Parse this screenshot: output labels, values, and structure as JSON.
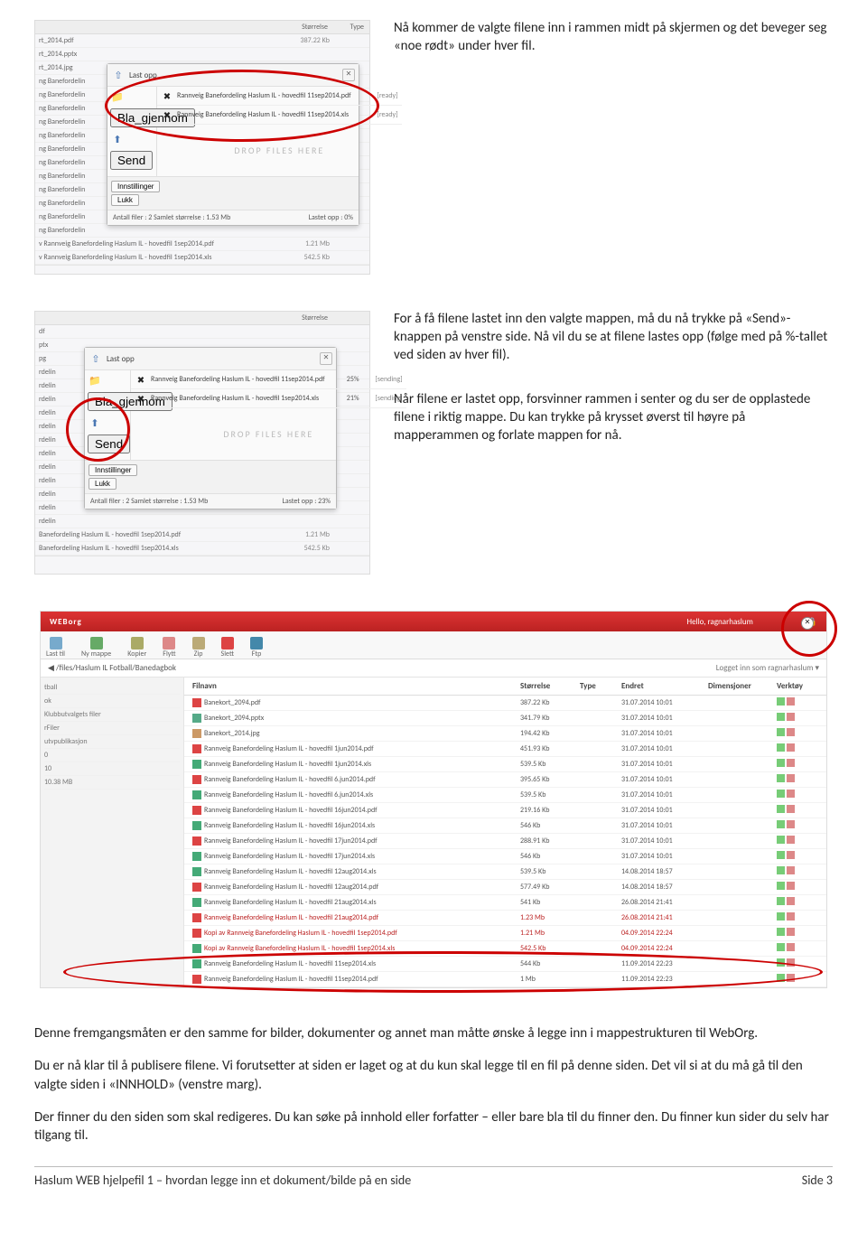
{
  "paragraphs": {
    "p1": "Nå kommer de valgte filene inn i rammen midt på skjermen og det beveger seg «noe rødt» under hver fil.",
    "p2": "For å få filene lastet inn den valgte mappen, må du nå trykke på «Send»-knappen på venstre side. Nå vil du se at filene lastes opp (følge med på %-tallet ved siden av hver fil).",
    "p3": "Når filene er lastet opp, forsvinner rammen i senter og du ser de opplastede filene i riktig mappe.  Du kan trykke på krysset øverst til høyre på mapperammen og forlate mappen for nå.",
    "p4": "Denne fremgangsmåten er den samme for bilder, dokumenter og annet man måtte ønske å legge inn i mappestrukturen til WebOrg.",
    "p5": "Du er nå klar til å publisere filene.  Vi forutsetter at siden er laget og at du kun skal legge til en fil på denne siden. Det vil si at du må gå til den valgte siden i «INNHOLD» (venstre marg).",
    "p6": "Der finner du den siden som skal redigeres.  Du kan søke på innhold eller forfatter – eller bare bla til du finner den. Du finner kun sider du selv har tilgang til."
  },
  "footer": {
    "left": "Haslum WEB hjelpefil 1 – hvordan legge inn et dokument/bilde på en side",
    "right": "Side 3"
  },
  "bgfiles": {
    "header": {
      "size": "Størrelse",
      "type": "Type"
    },
    "items": [
      [
        "rt_2014.pdf",
        "387.22 Kb",
        ""
      ],
      [
        "rt_2014.pptx",
        "",
        ""
      ],
      [
        "rt_2014.jpg",
        "",
        ""
      ],
      [
        "ng Banefordelin",
        "",
        ""
      ],
      [
        "ng Banefordelin",
        "",
        ""
      ],
      [
        "ng Banefordelin",
        "",
        ""
      ],
      [
        "ng Banefordelin",
        "",
        ""
      ],
      [
        "ng Banefordelin",
        "",
        ""
      ],
      [
        "ng Banefordelin",
        "",
        ""
      ],
      [
        "ng Banefordelin",
        "",
        ""
      ],
      [
        "ng Banefordelin",
        "",
        ""
      ],
      [
        "ng Banefordelin",
        "",
        ""
      ],
      [
        "ng Banefordelin",
        "",
        ""
      ],
      [
        "ng Banefordelin",
        "",
        ""
      ],
      [
        "ng Banefordelin",
        "",
        ""
      ],
      [
        "v Rannveig Banefordeling Haslum IL - hovedfil 1sep2014.pdf",
        "1.21 Mb",
        ""
      ],
      [
        "v Rannveig Banefordeling Haslum IL - hovedfil 1sep2014.xls",
        "542.5 Kb",
        ""
      ]
    ]
  },
  "bgfiles2": {
    "items": [
      [
        "df",
        "",
        ""
      ],
      [
        "ptx",
        "",
        ""
      ],
      [
        "pg",
        "",
        ""
      ],
      [
        "rdelin",
        "",
        ""
      ],
      [
        "rdelin",
        "",
        ""
      ],
      [
        "rdelin",
        "",
        ""
      ],
      [
        "rdelin",
        "",
        ""
      ],
      [
        "rdelin",
        "",
        ""
      ],
      [
        "rdelin",
        "",
        ""
      ],
      [
        "rdelin",
        "",
        ""
      ],
      [
        "rdelin",
        "",
        ""
      ],
      [
        "rdelin",
        "",
        ""
      ],
      [
        "rdelin",
        "",
        ""
      ],
      [
        "rdelin",
        "",
        ""
      ],
      [
        "rdelin",
        "",
        ""
      ],
      [
        "Banefordeling Haslum IL - hovedfil 1sep2014.pdf",
        "1.21 Mb",
        ""
      ],
      [
        "Banefordeling Haslum IL - hovedfil 1sep2014.xls",
        "542.5 Kb",
        ""
      ]
    ]
  },
  "panel1": {
    "head": "Last opp",
    "rows": [
      {
        "icon": "bla_gjennom",
        "name": "Rannveig Banefordeling Haslum IL - hovedfil 11sep2014.pdf",
        "status": "[ready]"
      },
      {
        "icon": "send",
        "name": "Rannveig Banefordeling Haslum IL - hovedfil 11sep2014.xls",
        "status": "[ready]"
      }
    ],
    "bla": "Bla_gjennom",
    "send": "Send",
    "drop": "DROP FILES HERE",
    "btns": [
      "Innstillinger",
      "Lukk"
    ],
    "foot_l": "Antall filer : 2 Samlet størrelse : 1.53 Mb",
    "foot_r": "Lastet opp : 0%"
  },
  "panel2": {
    "head": "Last opp",
    "rows": [
      {
        "name": "Rannveig Banefordeling Haslum IL - hovedfil 11sep2014.pdf",
        "pct": "25%",
        "status": "[sending]"
      },
      {
        "name": "Rannveig Banefordeling Haslum IL - hovedfil 1sep2014.xls",
        "pct": "21%",
        "status": "[sending]"
      }
    ],
    "bla": "Bla_gjennom",
    "send": "Send",
    "drop": "DROP FILES HERE",
    "btns": [
      "Innstillinger",
      "Lukk"
    ],
    "foot_l": "Antall filer : 2 Samlet størrelse : 1.53 Mb",
    "foot_r": "Lastet opp : 23%"
  },
  "web": {
    "brand": "WEBorg",
    "hello": "Hello, ragnarhaslum",
    "toolbar": [
      "Last til",
      "Ny mappe",
      "Kopier",
      "Flytt",
      "Zip",
      "Slett",
      "Ftp"
    ],
    "path": "/files/Haslum IL Fotball/Banedagbok",
    "login_as": "Logget inn som ragnarhaslum ▾",
    "side": [
      "tball",
      "ok",
      "Klubbutvalgets filer",
      "rFiler",
      "utvpublikasjon",
      "0",
      "10",
      "10.38 MB"
    ],
    "headers": [
      "Filnavn",
      "Størrelse",
      "Type",
      "Endret",
      "Dimensjoner",
      "Verktøy"
    ],
    "files": [
      [
        "pdf",
        "Banekort_2094.pdf",
        "387.22 Kb",
        "",
        "31.07.2014 10:01"
      ],
      [
        "doc",
        "Banekort_2094.pptx",
        "341.79 Kb",
        "",
        "31.07.2014 10:01"
      ],
      [
        "img",
        "Banekort_2014.jpg",
        "194.42 Kb",
        "",
        "31.07.2014 10:01"
      ],
      [
        "pdf",
        "Rannveig Banefordeling Haslum IL - hovedfil 1jun2014.pdf",
        "451.93 Kb",
        "",
        "31.07.2014 10:01"
      ],
      [
        "xls",
        "Rannveig Banefordeling Haslum IL - hovedfil 1jun2014.xls",
        "539.5 Kb",
        "",
        "31.07.2014 10:01"
      ],
      [
        "pdf",
        "Rannveig Banefordeling Haslum IL - hovedfil 6.jun2014.pdf",
        "395.65 Kb",
        "",
        "31.07.2014 10:01"
      ],
      [
        "xls",
        "Rannveig Banefordeling Haslum IL - hovedfil 6.jun2014.xls",
        "539.5 Kb",
        "",
        "31.07.2014 10:01"
      ],
      [
        "pdf",
        "Rannveig Banefordeling Haslum IL - hovedfil 16jun2014.pdf",
        "219.16 Kb",
        "",
        "31.07.2014 10:01"
      ],
      [
        "xls",
        "Rannveig Banefordeling Haslum IL - hovedfil 16jun2014.xls",
        "546 Kb",
        "",
        "31.07.2014 10:01"
      ],
      [
        "pdf",
        "Rannveig Banefordeling Haslum IL - hovedfil 17jun2014.pdf",
        "288.91 Kb",
        "",
        "31.07.2014 10:01"
      ],
      [
        "xls",
        "Rannveig Banefordeling Haslum IL - hovedfil 17jun2014.xls",
        "546 Kb",
        "",
        "31.07.2014 10:01"
      ],
      [
        "xls",
        "Rannveig Banefordeling Haslum IL - hovedfil 12aug2014.xls",
        "539.5 Kb",
        "",
        "14.08.2014 18:57"
      ],
      [
        "pdf",
        "Rannveig Banefordeling Haslum IL - hovedfil 12aug2014.pdf",
        "577.49 Kb",
        "",
        "14.08.2014 18:57"
      ],
      [
        "xls",
        "Rannveig Banefordeling Haslum IL - hovedfil 21aug2014.xls",
        "541 Kb",
        "",
        "26.08.2014 21:41"
      ],
      [
        "pdf",
        "Rannveig Banefordeling Haslum IL - hovedfil 21aug2014.pdf",
        "1.23 Mb",
        "",
        "26.08.2014 21:41"
      ],
      [
        "pdf",
        "Kopi av Rannveig Banefordeling Haslum IL - hovedfil 1sep2014.pdf",
        "1.21 Mb",
        "",
        "04.09.2014 22:24"
      ],
      [
        "xls",
        "Kopi av Rannveig Banefordeling Haslum IL - hovedfil 1sep2014.xls",
        "542.5 Kb",
        "",
        "04.09.2014 22:24"
      ],
      [
        "xls",
        "Rannveig Banefordeling Haslum IL - hovedfil 11sep2014.xls",
        "544 Kb",
        "",
        "11.09.2014 22:23"
      ],
      [
        "pdf",
        "Rannveig Banefordeling Haslum IL - hovedfil 11sep2014.pdf",
        "1 Mb",
        "",
        "11.09.2014 22:23"
      ]
    ]
  }
}
